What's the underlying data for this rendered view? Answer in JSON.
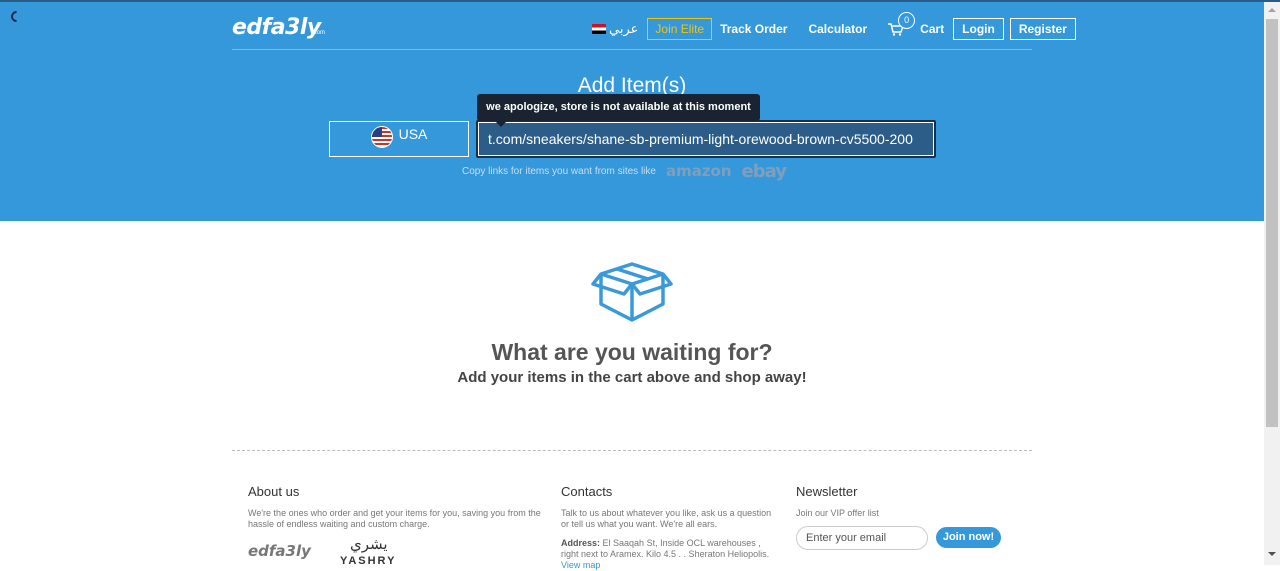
{
  "header": {
    "logo_text": "edfa3ly",
    "logo_suffix": ".com",
    "lang_label": "عربي",
    "join_elite": "Join Elite",
    "track_order": "Track Order",
    "calculator": "Calculator",
    "cart_count": "0",
    "cart_label": "Cart",
    "login": "Login",
    "register": "Register"
  },
  "search": {
    "title": "Add Item(s)",
    "country": "USA",
    "url_value": "t.com/sneakers/shane-sb-premium-light-orewood-brown-cv5500-200",
    "tooltip": "we apologize, store is not available at this moment",
    "hint": "Copy links for items you want from sites like",
    "brands": [
      "amazon",
      "ebay"
    ]
  },
  "empty_state": {
    "title": "What are you waiting for?",
    "subtitle": "Add your items in the cart above and shop away!"
  },
  "footer": {
    "about": {
      "heading": "About us",
      "text": "We're the ones who order and get your items for you, saving you from the hassle of endless waiting and custom charge.",
      "logo": "edfa3ly",
      "yashry_ar": "يشري",
      "yashry": "YASHRY"
    },
    "contacts": {
      "heading": "Contacts",
      "text": "Talk to us about whatever you like, ask us a question or tell us what you want. We're all ears.",
      "address_label": "Address:",
      "address": "El Saaqah St, Inside OCL warehouses , right next to Aramex. Kilo 4.5 . . Sheraton Heliopolis.",
      "view_map": "View map"
    },
    "newsletter": {
      "heading": "Newsletter",
      "text": "Join our VIP offer list",
      "email_placeholder": "Enter your email",
      "join_button": "Join now!"
    }
  },
  "colors": {
    "hero": "#3498db",
    "elite": "#f1c40f",
    "tooltip": "#1a2332"
  }
}
